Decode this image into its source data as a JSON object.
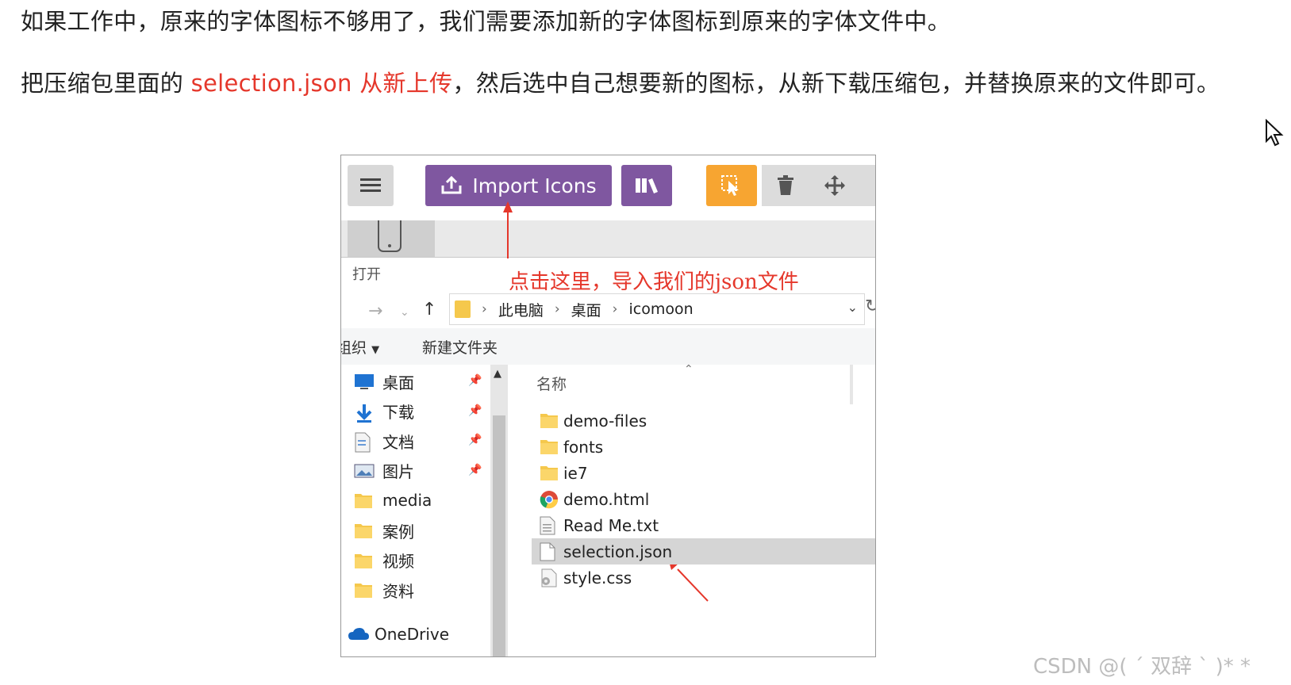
{
  "text": {
    "p1": "如果工作中，原来的字体图标不够用了，我们需要添加新的字体图标到原来的字体文件中。",
    "p2_before": "把压缩包里面的 ",
    "p2_highlight": "selection.json 从新上传",
    "p2_after": "，然后选中自己想要新的图标，从新下载压缩包，并替换原来的文件即可。"
  },
  "toolbar": {
    "import_label": "Import Icons"
  },
  "dialog": {
    "title": "打开",
    "annotation": "点击这里，导入我们的json文件",
    "breadcrumbs": [
      "此电脑",
      "桌面",
      "icomoon"
    ],
    "organize": "组织",
    "new_folder": "新建文件夹",
    "nav_items": [
      {
        "label": "桌面",
        "icon": "desktop-icon",
        "pinned": true
      },
      {
        "label": "下载",
        "icon": "download-icon",
        "pinned": true
      },
      {
        "label": "文档",
        "icon": "document-icon",
        "pinned": true
      },
      {
        "label": "图片",
        "icon": "picture-icon",
        "pinned": true
      },
      {
        "label": "media",
        "icon": "folder-icon",
        "pinned": false
      },
      {
        "label": "案例",
        "icon": "folder-icon",
        "pinned": false
      },
      {
        "label": "视频",
        "icon": "folder-icon",
        "pinned": false
      },
      {
        "label": "资料",
        "icon": "folder-icon",
        "pinned": false
      }
    ],
    "onedrive": "OneDrive",
    "column_name": "名称",
    "files": [
      {
        "name": "demo-files",
        "icon": "folder-icon",
        "selected": false
      },
      {
        "name": "fonts",
        "icon": "folder-icon",
        "selected": false
      },
      {
        "name": "ie7",
        "icon": "folder-icon",
        "selected": false
      },
      {
        "name": "demo.html",
        "icon": "chrome-icon",
        "selected": false
      },
      {
        "name": "Read Me.txt",
        "icon": "text-file-icon",
        "selected": false
      },
      {
        "name": "selection.json",
        "icon": "file-icon",
        "selected": true
      },
      {
        "name": "style.css",
        "icon": "css-file-icon",
        "selected": false
      }
    ]
  },
  "watermark": "CSDN @( ´ 双辞 ` )*   *",
  "colors": {
    "highlight": "#e5372b",
    "purple": "#7f57a0",
    "orange": "#f7a531",
    "folder": "#f5c84c"
  }
}
